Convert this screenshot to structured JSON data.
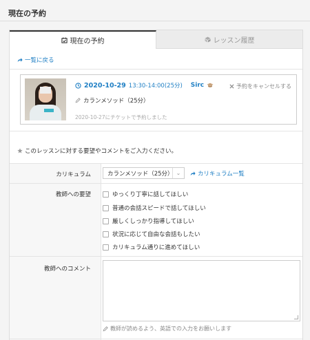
{
  "page": {
    "title": "現在の予約"
  },
  "tabs": [
    {
      "label": "現在の予約",
      "active": true,
      "icon": "calendar-check-icon"
    },
    {
      "label": "レッスン履歴",
      "active": false,
      "icon": "cubes-icon"
    }
  ],
  "back_link": {
    "label": "一覧に戻る"
  },
  "lesson": {
    "date": "2020-10-29",
    "time": "13:30-14:00(25分)",
    "teacher": "Sirc",
    "cancel_label": "予約をキャンセルする",
    "course": "カランメソッド（25分）",
    "booked_note": "2020-10-27にチケットで予約しました"
  },
  "note": "このレッスンに対する要望やコメントをご入力ください。",
  "form": {
    "curriculum": {
      "label": "カリキュラム",
      "selected": "カランメソッド（25分）",
      "link": "カリキュラム一覧"
    },
    "requests": {
      "label": "教師への要望",
      "options": [
        "ゆっくり丁寧に話してほしい",
        "普通の会話スピードで話してほしい",
        "厳しくしっかり指導してほしい",
        "状況に応じて自由な会話もしたい",
        "カリキュラム通りに進めてほしい"
      ]
    },
    "comment": {
      "label": "教師へのコメント",
      "value": "",
      "hint": "教師が読めるよう、英語での入力をお願いします"
    }
  },
  "colors": {
    "accent": "#1f7fc4",
    "panel_border": "#dddddd"
  }
}
